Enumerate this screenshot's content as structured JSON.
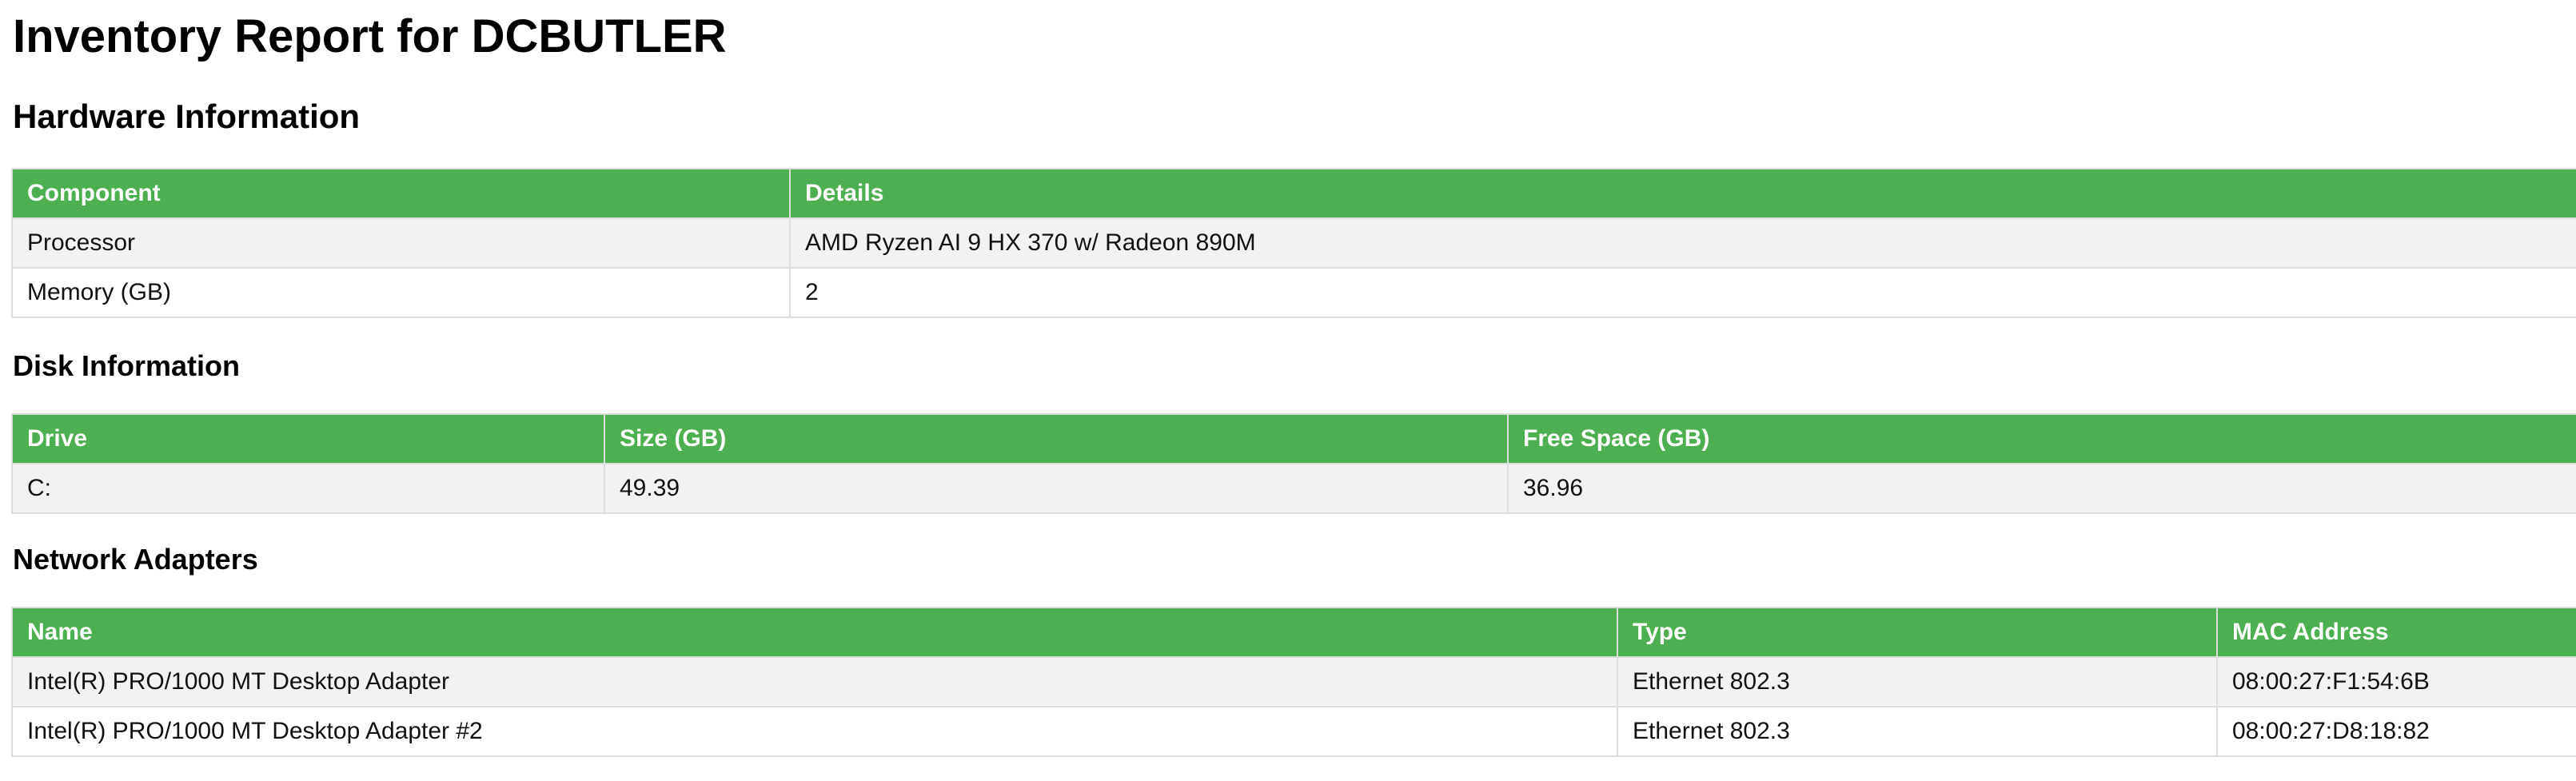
{
  "title": "Inventory Report for DCBUTLER",
  "colors": {
    "header_bg": "#4caf50",
    "header_text": "#ffffff",
    "row_alt_bg": "#f2f2f2",
    "border": "#dddddd"
  },
  "hardware": {
    "heading": "Hardware Information",
    "columns": [
      "Component",
      "Details"
    ],
    "rows": [
      [
        "Processor",
        "AMD Ryzen AI 9 HX 370 w/ Radeon 890M"
      ],
      [
        "Memory (GB)",
        "2"
      ]
    ]
  },
  "disk": {
    "heading": "Disk Information",
    "columns": [
      "Drive",
      "Size (GB)",
      "Free Space (GB)"
    ],
    "rows": [
      [
        "C:",
        "49.39",
        "36.96"
      ]
    ]
  },
  "network": {
    "heading": "Network Adapters",
    "columns": [
      "Name",
      "Type",
      "MAC Address"
    ],
    "rows": [
      [
        "Intel(R) PRO/1000 MT Desktop Adapter",
        "Ethernet 802.3",
        "08:00:27:F1:54:6B"
      ],
      [
        "Intel(R) PRO/1000 MT Desktop Adapter #2",
        "Ethernet 802.3",
        "08:00:27:D8:18:82"
      ]
    ]
  }
}
